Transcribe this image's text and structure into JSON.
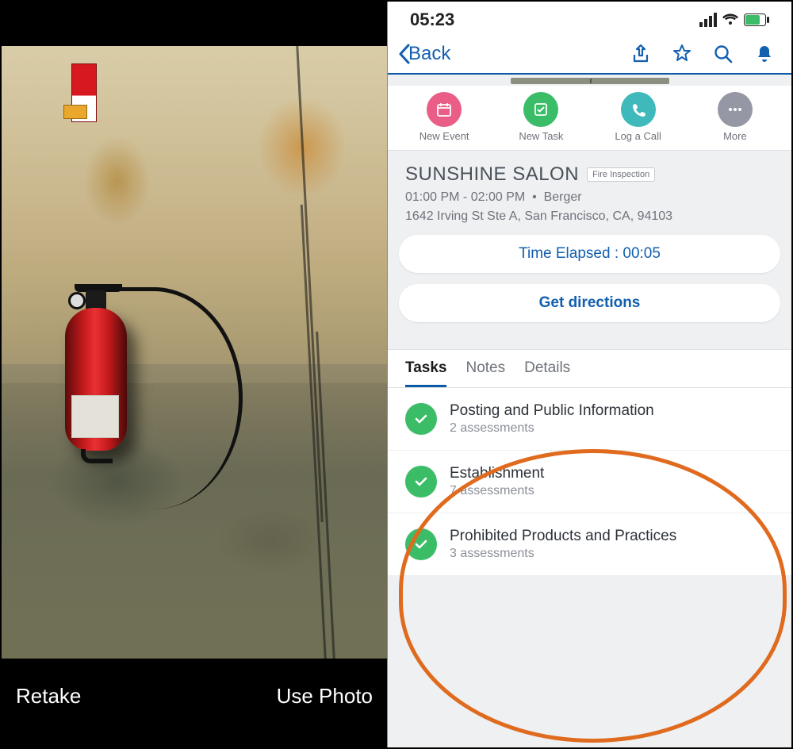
{
  "left": {
    "retake_label": "Retake",
    "use_photo_label": "Use Photo"
  },
  "status": {
    "time": "05:23"
  },
  "nav": {
    "back_label": "Back"
  },
  "quick_actions": [
    {
      "label": "New Event",
      "color": "#ea5d87",
      "icon": "calendar"
    },
    {
      "label": "New Task",
      "color": "#3bbd68",
      "icon": "checklist"
    },
    {
      "label": "Log a Call",
      "color": "#3fb9bb",
      "icon": "phone"
    },
    {
      "label": "More",
      "color": "#9598a4",
      "icon": "dots"
    }
  ],
  "record": {
    "title": "SUNSHINE SALON",
    "tag": "Fire Inspection",
    "time_range": "01:00 PM - 02:00 PM",
    "owner": "Berger",
    "address": "1642 Irving St Ste A, San Francisco, CA, 94103"
  },
  "pills": {
    "time_elapsed_label": "Time Elapsed : 00:05",
    "directions_label": "Get directions"
  },
  "tabs": [
    {
      "label": "Tasks",
      "active": true
    },
    {
      "label": "Notes",
      "active": false
    },
    {
      "label": "Details",
      "active": false
    }
  ],
  "tasks": [
    {
      "title": "Posting and Public Information",
      "sub": "2 assessments"
    },
    {
      "title": "Establishment",
      "sub": "7 assessments"
    },
    {
      "title": "Prohibited Products and Practices",
      "sub": "3 assessments"
    }
  ]
}
